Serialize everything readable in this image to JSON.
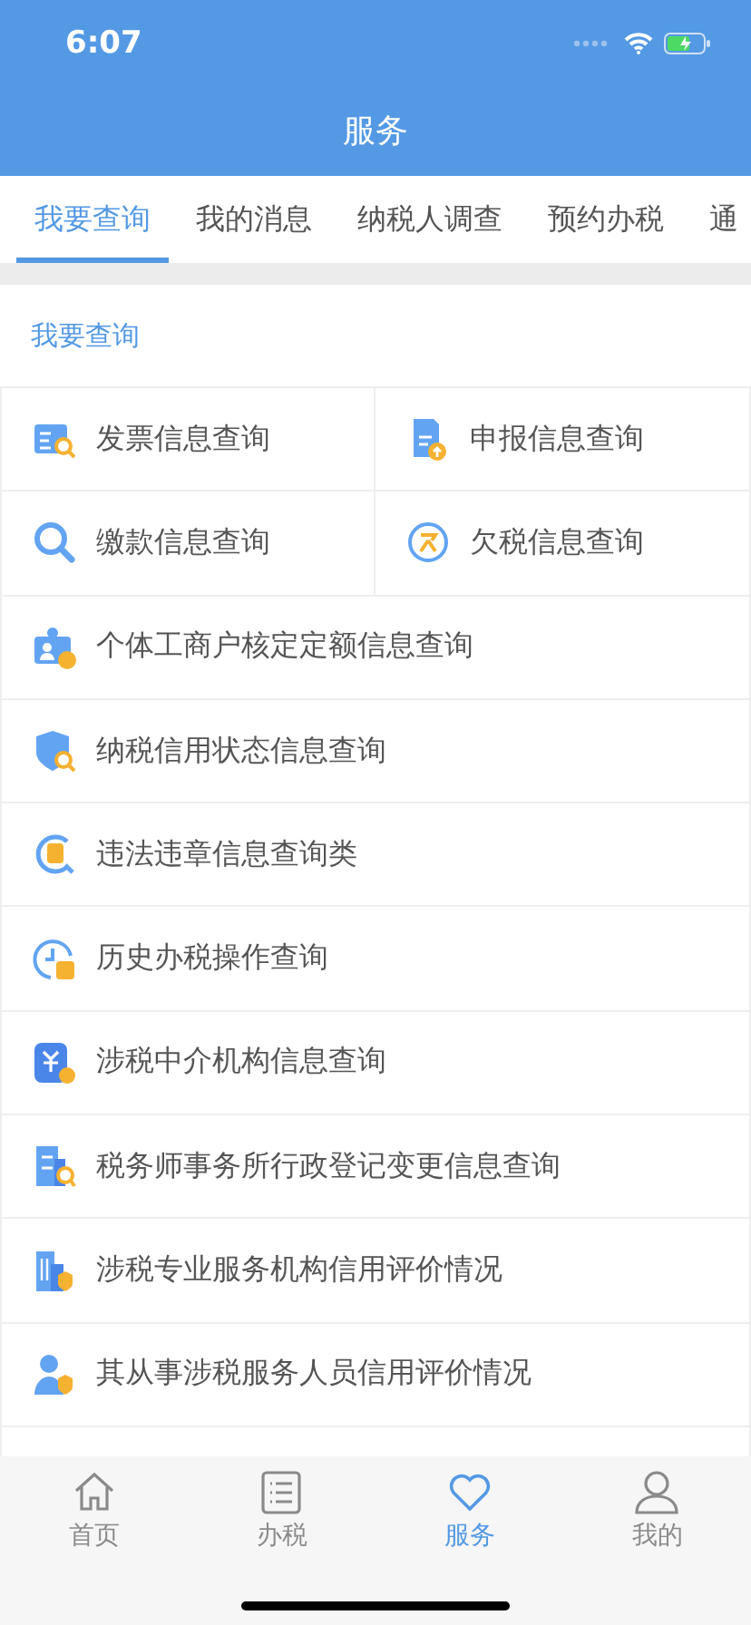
{
  "status_bar": {
    "time": "6:07"
  },
  "header": {
    "title": "服务"
  },
  "tabs": [
    {
      "label": "我要查询",
      "selected": true
    },
    {
      "label": "我的消息",
      "selected": false
    },
    {
      "label": "纳税人调查",
      "selected": false
    },
    {
      "label": "预约办税",
      "selected": false
    },
    {
      "label": "通",
      "selected": false
    }
  ],
  "section": {
    "title": "我要查询"
  },
  "items": [
    {
      "label": "发票信息查询",
      "kind": "half"
    },
    {
      "label": "申报信息查询",
      "kind": "half"
    },
    {
      "label": "缴款信息查询",
      "kind": "half"
    },
    {
      "label": "欠税信息查询",
      "kind": "half"
    },
    {
      "label": "个体工商户核定定额信息查询",
      "kind": "full"
    },
    {
      "label": "纳税信用状态信息查询",
      "kind": "full"
    },
    {
      "label": "违法违章信息查询类",
      "kind": "full"
    },
    {
      "label": "历史办税操作查询",
      "kind": "full"
    },
    {
      "label": "涉税中介机构信息查询",
      "kind": "full"
    },
    {
      "label": "税务师事务所行政登记变更信息查询",
      "kind": "full"
    },
    {
      "label": "涉税专业服务机构信用评价情况",
      "kind": "full"
    },
    {
      "label": "其从事涉税服务人员信用评价情况",
      "kind": "full"
    }
  ],
  "bottom_nav": [
    {
      "label": "首页",
      "selected": false
    },
    {
      "label": "办税",
      "selected": false
    },
    {
      "label": "服务",
      "selected": true
    },
    {
      "label": "我的",
      "selected": false
    }
  ]
}
